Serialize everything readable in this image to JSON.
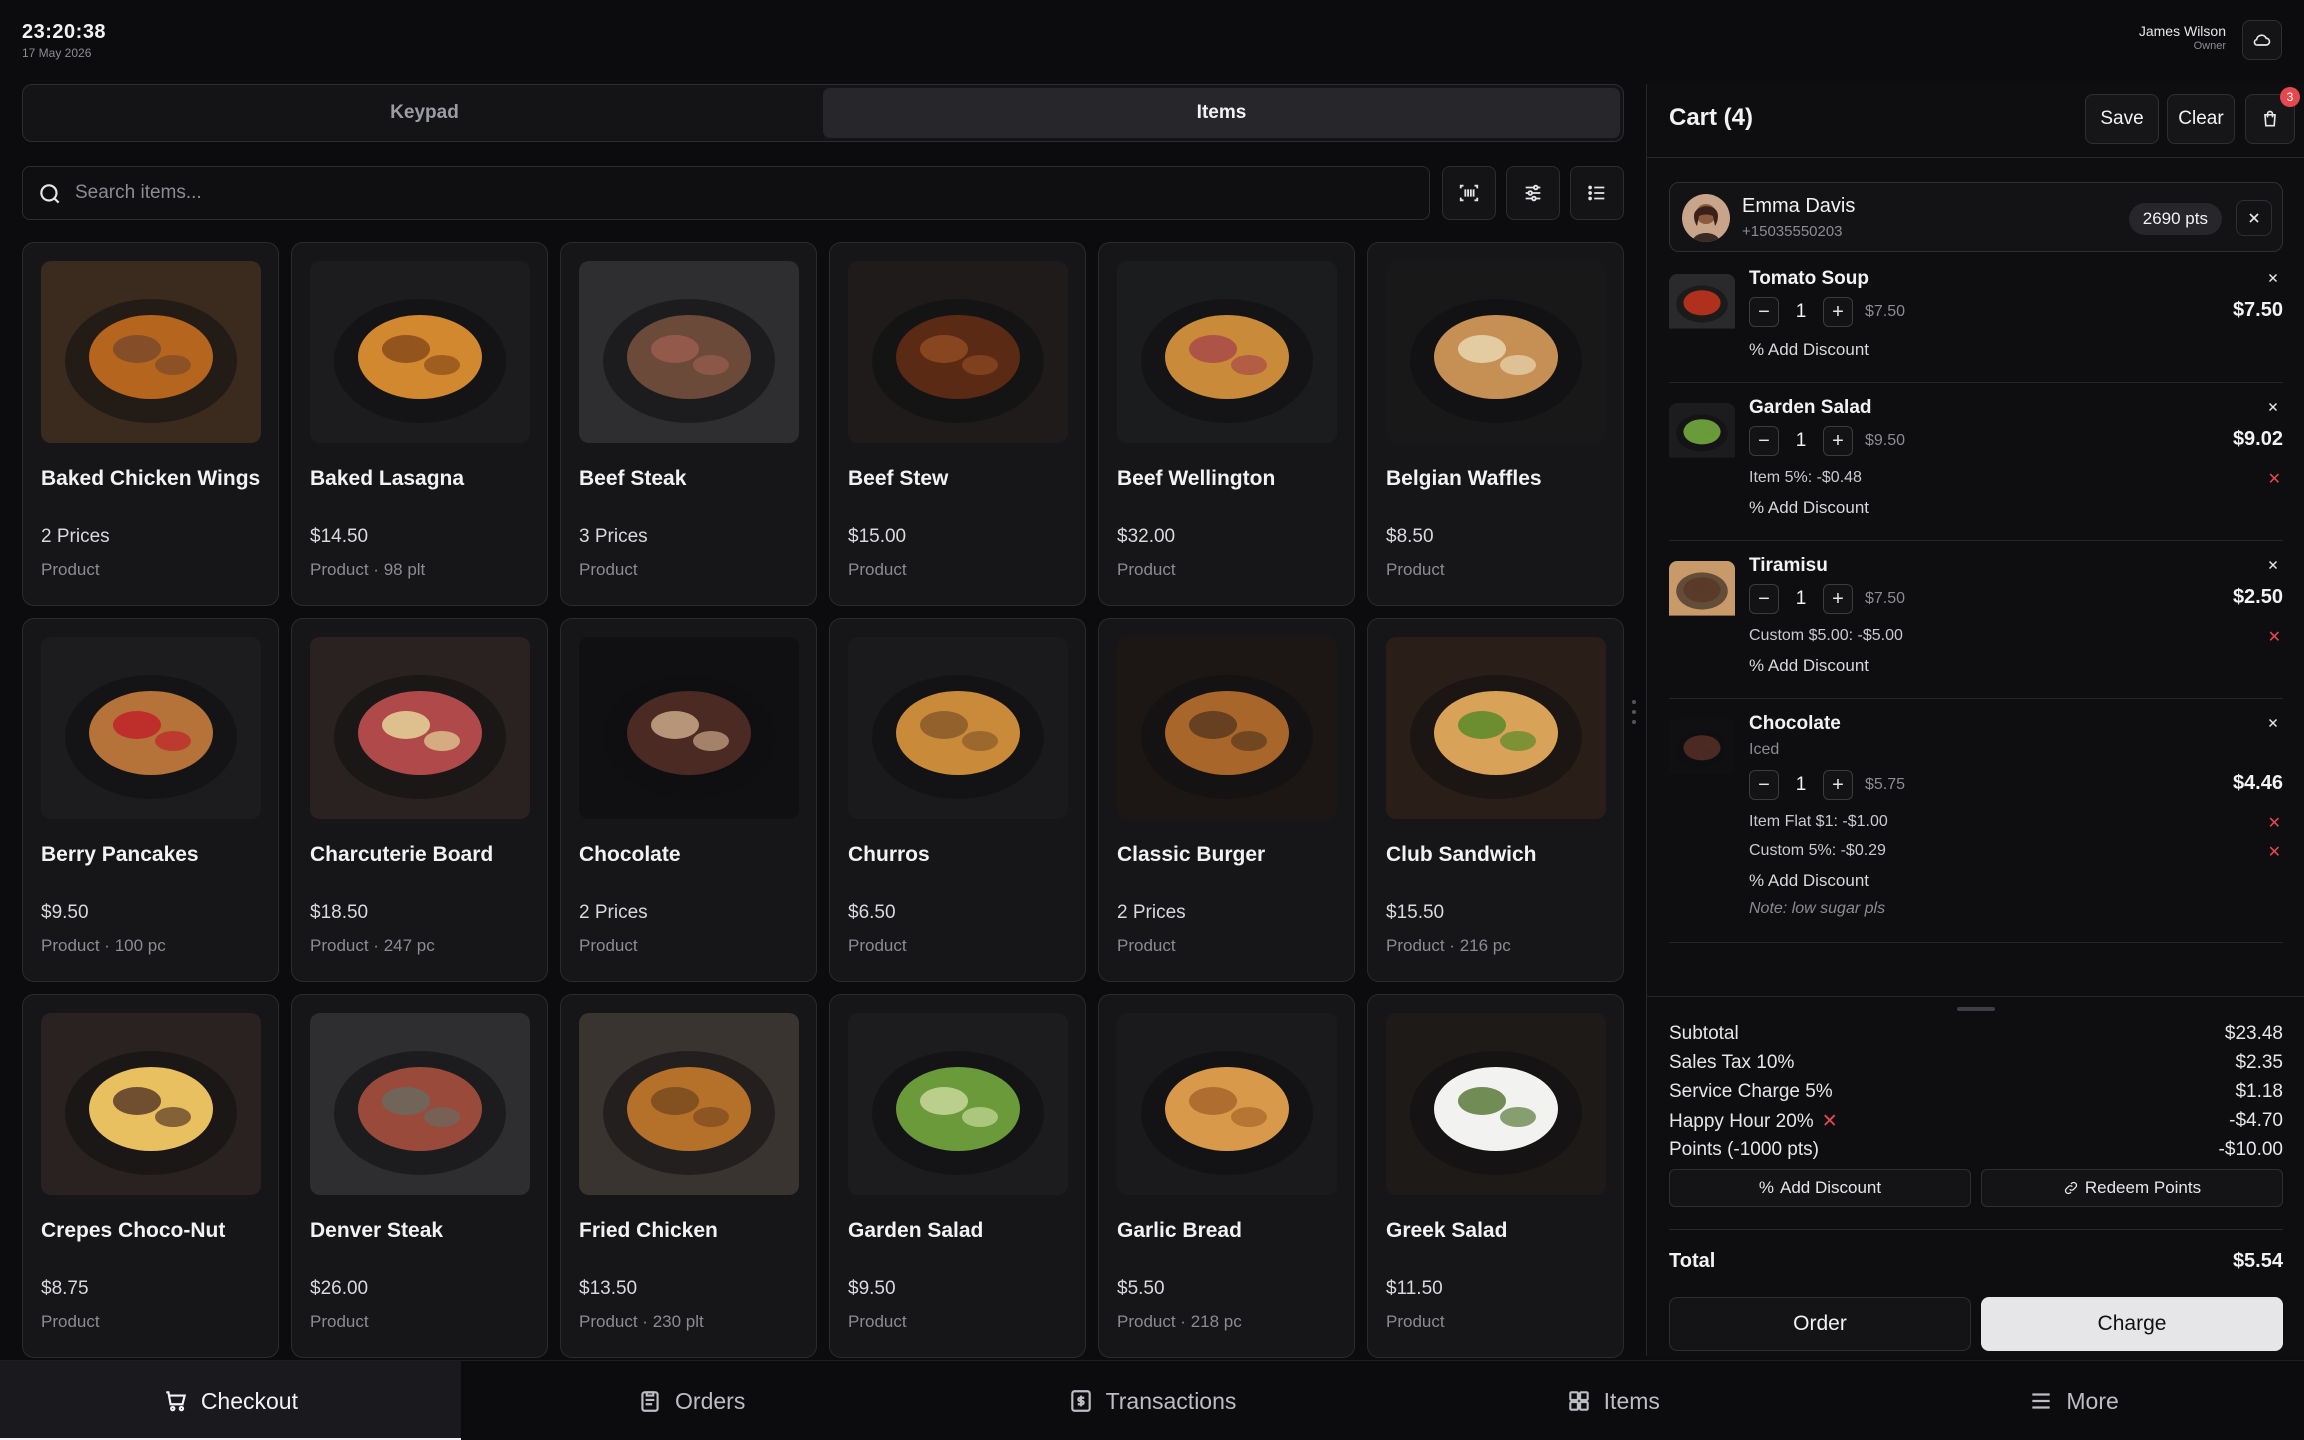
{
  "topbar": {
    "time": "23:20:38",
    "date": "17 May 2026",
    "user_name": "James Wilson",
    "user_role": "Owner"
  },
  "tabs": {
    "keypad": "Keypad",
    "items": "Items"
  },
  "search": {
    "placeholder": "Search items..."
  },
  "products": [
    {
      "name": "Baked Chicken Wings",
      "price": "2 Prices",
      "meta": "Product",
      "colors": [
        "#3b2a1e",
        "#b5651d",
        "#7a4a2a"
      ]
    },
    {
      "name": "Baked Lasagna",
      "price": "$14.50",
      "meta": "Product · 98 plt",
      "colors": [
        "#1c1c1e",
        "#d2882f",
        "#8a4b1a"
      ]
    },
    {
      "name": "Beef Steak",
      "price": "3 Prices",
      "meta": "Product",
      "colors": [
        "#2e2e30",
        "#6b4a3a",
        "#9a5d50"
      ]
    },
    {
      "name": "Beef Stew",
      "price": "$15.00",
      "meta": "Product",
      "colors": [
        "#1e1b1a",
        "#5a2a14",
        "#8f4a22"
      ]
    },
    {
      "name": "Beef Wellington",
      "price": "$32.00",
      "meta": "Product",
      "colors": [
        "#1b1c1e",
        "#c98a3a",
        "#a94a4a"
      ]
    },
    {
      "name": "Belgian Waffles",
      "price": "$8.50",
      "meta": "Product",
      "colors": [
        "#181819",
        "#c69055",
        "#e8d6b0"
      ]
    },
    {
      "name": "Berry Pancakes",
      "price": "$9.50",
      "meta": "Product · 100 pc",
      "colors": [
        "#1c1c1e",
        "#b5733a",
        "#c0232a"
      ]
    },
    {
      "name": "Charcuterie Board",
      "price": "$18.50",
      "meta": "Product · 247 pc",
      "colors": [
        "#2a2220",
        "#b04a4a",
        "#e6d49a"
      ]
    },
    {
      "name": "Chocolate",
      "price": "2 Prices",
      "meta": "Product",
      "colors": [
        "#101012",
        "#4a2a22",
        "#c9a888"
      ]
    },
    {
      "name": "Churros",
      "price": "$6.50",
      "meta": "Product",
      "colors": [
        "#1a1a1c",
        "#c98a3a",
        "#8a5a2a"
      ]
    },
    {
      "name": "Classic Burger",
      "price": "2 Prices",
      "meta": "Product",
      "colors": [
        "#1c1714",
        "#a8662a",
        "#5a3a20"
      ]
    },
    {
      "name": "Club Sandwich",
      "price": "$15.50",
      "meta": "Product · 216 pc",
      "colors": [
        "#2a1e18",
        "#d8a258",
        "#5a8a2a"
      ]
    },
    {
      "name": "Crepes Choco-Nut",
      "price": "$8.75",
      "meta": "Product",
      "colors": [
        "#2a2220",
        "#e8c060",
        "#5a3a28"
      ]
    },
    {
      "name": "Denver Steak",
      "price": "$26.00",
      "meta": "Product",
      "colors": [
        "#2e2e30",
        "#9a4a3a",
        "#6a6a60"
      ]
    },
    {
      "name": "Fried Chicken",
      "price": "$13.50",
      "meta": "Product · 230 plt",
      "colors": [
        "#3a3430",
        "#b5702a",
        "#7a4a1e"
      ]
    },
    {
      "name": "Garden Salad",
      "price": "$9.50",
      "meta": "Product",
      "colors": [
        "#1c1c1e",
        "#6a9a3a",
        "#c8d89a"
      ]
    },
    {
      "name": "Garlic Bread",
      "price": "$5.50",
      "meta": "Product · 218 pc",
      "colors": [
        "#1a1a1c",
        "#d89a4a",
        "#a8662a"
      ]
    },
    {
      "name": "Greek Salad",
      "price": "$11.50",
      "meta": "Product",
      "colors": [
        "#1e1a18",
        "#f2f2f0",
        "#5a7a3a"
      ]
    }
  ],
  "cart": {
    "title": "Cart (4)",
    "save_label": "Save",
    "clear_label": "Clear",
    "badge_count": "3",
    "customer": {
      "name": "Emma Davis",
      "phone": "+15035550203",
      "points": "2690 pts"
    },
    "lines": [
      {
        "name": "Tomato Soup",
        "variant": "",
        "qty": "1",
        "unit": "$7.50",
        "total": "$7.50",
        "discounts": [],
        "add_discount": "Add Discount",
        "note": "",
        "colors": [
          "#2a2a2c",
          "#b0301e"
        ]
      },
      {
        "name": "Garden Salad",
        "variant": "",
        "qty": "1",
        "unit": "$9.50",
        "total": "$9.02",
        "discounts": [
          "Item 5%: -$0.48"
        ],
        "add_discount": "Add Discount",
        "note": "",
        "colors": [
          "#1c1c1e",
          "#6a9a3a"
        ]
      },
      {
        "name": "Tiramisu",
        "variant": "",
        "qty": "1",
        "unit": "$7.50",
        "total": "$2.50",
        "discounts": [
          "Custom $5.00: -$5.00"
        ],
        "add_discount": "Add Discount",
        "note": "",
        "colors": [
          "#c89a6a",
          "#5a3a28"
        ]
      },
      {
        "name": "Chocolate",
        "variant": "Iced",
        "qty": "1",
        "unit": "$5.75",
        "total": "$4.46",
        "discounts": [
          "Item Flat $1: -$1.00",
          "Custom 5%: -$0.29"
        ],
        "add_discount": "Add Discount",
        "note": "Note: low sugar pls",
        "colors": [
          "#101012",
          "#4a2a22"
        ]
      }
    ],
    "summary": [
      {
        "label": "Subtotal",
        "value": "$23.48",
        "removable": false
      },
      {
        "label": "Sales Tax 10%",
        "value": "$2.35",
        "removable": false
      },
      {
        "label": "Service Charge 5%",
        "value": "$1.18",
        "removable": false
      },
      {
        "label": "Happy Hour 20%",
        "value": "-$4.70",
        "removable": true
      },
      {
        "label": "Points (-1000 pts)",
        "value": "-$10.00",
        "removable": false
      }
    ],
    "add_discount_label": "Add Discount",
    "redeem_points_label": "Redeem Points",
    "total_label": "Total",
    "total_value": "$5.54",
    "order_label": "Order",
    "charge_label": "Charge"
  },
  "nav": [
    {
      "label": "Checkout",
      "icon": "cart-icon",
      "active": true
    },
    {
      "label": "Orders",
      "icon": "clipboard-icon",
      "active": false
    },
    {
      "label": "Transactions",
      "icon": "receipt-icon",
      "active": false
    },
    {
      "label": "Items",
      "icon": "grid-icon",
      "active": false
    },
    {
      "label": "More",
      "icon": "menu-icon",
      "active": false
    }
  ]
}
